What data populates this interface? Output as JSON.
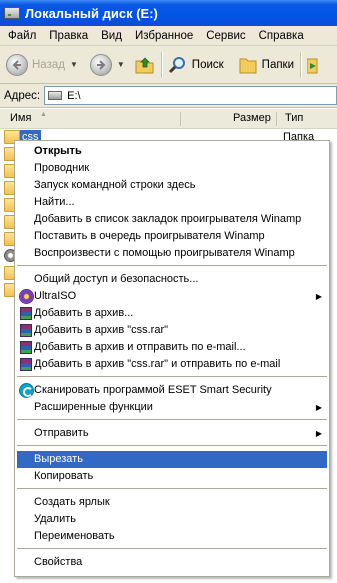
{
  "window": {
    "title": "Локальный диск (E:)"
  },
  "menubar": [
    "Файл",
    "Правка",
    "Вид",
    "Избранное",
    "Сервис",
    "Справка"
  ],
  "toolbar": {
    "back_label": "Назад",
    "search_label": "Поиск",
    "folders_label": "Папки"
  },
  "address": {
    "label": "Адрес:",
    "value": "E:\\"
  },
  "list": {
    "columns": {
      "name": "Имя",
      "size": "Размер",
      "type": "Тип"
    },
    "selected_item": {
      "name": "css",
      "type": "Папка"
    }
  },
  "context_menu": {
    "open": "Открыть",
    "explorer": "Проводник",
    "cmd_here": "Запуск командной строки здесь",
    "find": "Найти...",
    "winamp_bookmark": "Добавить в список закладок проигрывателя Winamp",
    "winamp_enqueue": "Поставить в очередь проигрывателя Winamp",
    "winamp_play": "Воспроизвести с помощью проигрывателя Winamp",
    "sharing": "Общий доступ и безопасность...",
    "ultraiso": "UltraISO",
    "add_archive": "Добавить в архив...",
    "add_css_rar": "Добавить в архив \"css.rar\"",
    "add_email": "Добавить в архив и отправить по e-mail...",
    "add_css_rar_email": "Добавить в архив \"css.rar\" и отправить по e-mail",
    "eset_scan": "Сканировать программой ESET Smart Security",
    "advanced": "Расширенные функции",
    "send_to": "Отправить",
    "cut": "Вырезать",
    "copy": "Копировать",
    "create_shortcut": "Создать ярлык",
    "delete": "Удалить",
    "rename": "Переименовать",
    "properties": "Свойства"
  },
  "colors": {
    "selection": "#316ac5",
    "titlebar": "#0054e3",
    "chrome": "#ece9d8"
  }
}
